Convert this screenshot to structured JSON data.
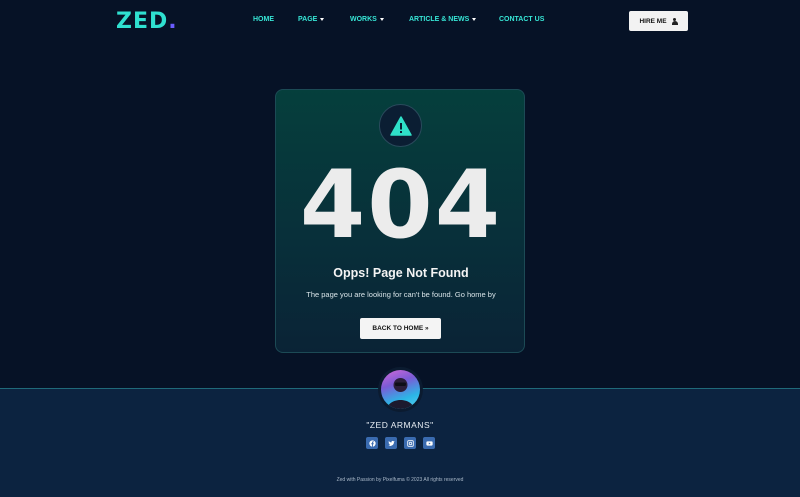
{
  "brand": {
    "logo_text": "ZED",
    "logo_dot": ".",
    "accent": "#2fe0d0",
    "dot_color": "#6a5cff"
  },
  "nav": {
    "items": [
      {
        "label": "HOME",
        "has_caret": false
      },
      {
        "label": "PAGE",
        "has_caret": true
      },
      {
        "label": "WORKS",
        "has_caret": true
      },
      {
        "label": "ARTICLE & NEWS",
        "has_caret": true
      },
      {
        "label": "CONTACT US",
        "has_caret": false
      }
    ],
    "hire_label": "HIRE ME",
    "hire_icon": "user-icon"
  },
  "error": {
    "icon": "warning-icon",
    "code": "404",
    "title": "Opps! Page Not Found",
    "description": "The page you are looking for can't be found. Go home by",
    "button_label": "BACK TO HOME »"
  },
  "footer": {
    "author": "\"ZED ARMANS\"",
    "socials": [
      "facebook-icon",
      "twitter-icon",
      "dribbble-icon",
      "youtube-icon"
    ],
    "copyright": "Zed with Passion by Pixelfuma © 2023 All rights reserved"
  },
  "colors": {
    "background": "#061226",
    "footer": "#0c2340",
    "card_top": "#053f3c"
  }
}
